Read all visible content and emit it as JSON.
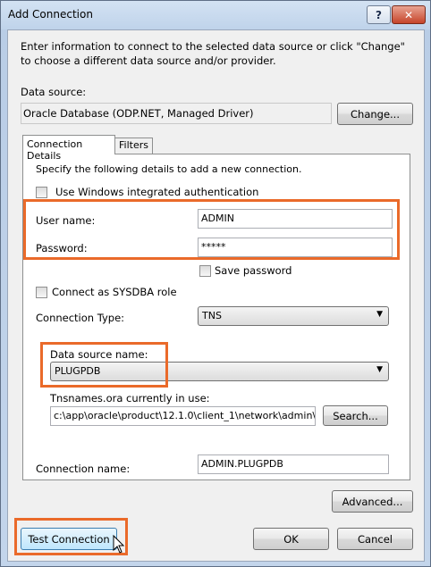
{
  "window": {
    "title": "Add Connection",
    "help_glyph": "?",
    "close_glyph": "✕"
  },
  "intro_text": "Enter information to connect to the selected data source or click \"Change\" to choose a different data source and/or provider.",
  "data_source": {
    "label": "Data source:",
    "value": "Oracle Database (ODP.NET, Managed Driver)",
    "change_button": "Change..."
  },
  "tabs": [
    {
      "label": "Connection Details",
      "active": true
    },
    {
      "label": "Filters",
      "active": false
    }
  ],
  "details": {
    "instruction": "Specify the following details to add a new connection.",
    "use_windows_auth": {
      "label": "Use Windows integrated authentication",
      "checked": false
    },
    "user_name": {
      "label": "User name:",
      "value": "ADMIN"
    },
    "password": {
      "label": "Password:",
      "value": "*****"
    },
    "save_password": {
      "label": "Save password",
      "checked": false
    },
    "sysdba": {
      "label": "Connect as SYSDBA role",
      "checked": false
    },
    "connection_type": {
      "label": "Connection Type:",
      "value": "TNS"
    },
    "data_source_name": {
      "label": "Data source name:",
      "value": "PLUGPDB"
    },
    "tnsnames": {
      "label": "Tnsnames.ora currently in use:",
      "value": "c:\\app\\oracle\\product\\12.1.0\\client_1\\network\\admin\\tnsnam",
      "search_button": "Search..."
    },
    "connection_name": {
      "label": "Connection name:",
      "value": "ADMIN.PLUGPDB"
    }
  },
  "buttons": {
    "advanced": "Advanced...",
    "test_connection": "Test Connection",
    "ok": "OK",
    "cancel": "Cancel"
  },
  "colors": {
    "highlight": "#ea6a2a"
  },
  "icons": {
    "dropdown": "chevron-down-icon",
    "cursor": "mouse-pointer-icon"
  }
}
